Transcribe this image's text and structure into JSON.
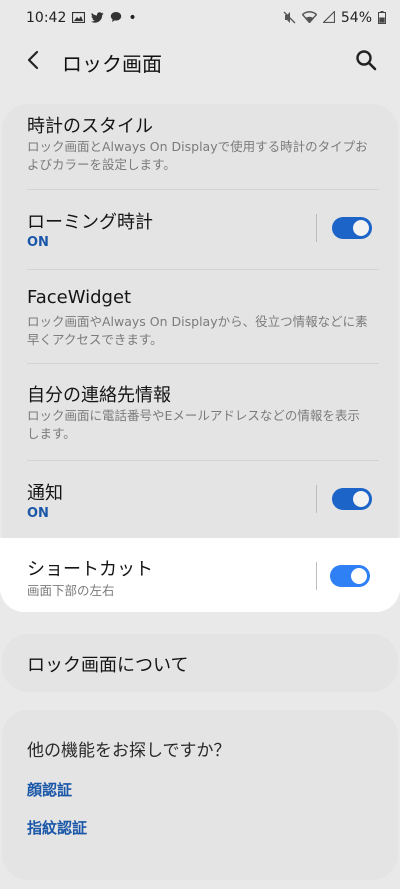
{
  "status_bar": {
    "time": "10:42",
    "dot": "•",
    "battery": "54%",
    "icons": [
      "image-icon",
      "twitter-icon",
      "chat-icon",
      "mute-icon",
      "wifi-icon",
      "signal-icon",
      "battery-icon"
    ]
  },
  "app_bar": {
    "title": "ロック画面"
  },
  "settings": {
    "clock_style": {
      "title": "時計のスタイル",
      "desc": "ロック画面とAlways On Displayで使用する時計のタイプおよびカラーを設定します。"
    },
    "roaming_clock": {
      "title": "ローミング時計",
      "status": "ON",
      "enabled": true
    },
    "facewidget": {
      "title": "FaceWidget",
      "desc": "ロック画面やAlways On Displayから、役立つ情報などに素早くアクセスできます。"
    },
    "contact_info": {
      "title": "自分の連絡先情報",
      "desc": "ロック画面に電話番号やEメールアドレスなどの情報を表示します。"
    },
    "notifications": {
      "title": "通知",
      "status": "ON",
      "enabled": true
    },
    "shortcuts": {
      "title": "ショートカット",
      "desc": "画面下部の左右",
      "enabled": true
    }
  },
  "about": {
    "label": "ロック画面について"
  },
  "more_features": {
    "title": "他の機能をお探しですか？",
    "links": [
      "顔認証",
      "指紋認証"
    ]
  },
  "colors": {
    "accent": "#1a57a8",
    "toggle_on": "#2f7ff5",
    "background": "#e9e9e9"
  }
}
